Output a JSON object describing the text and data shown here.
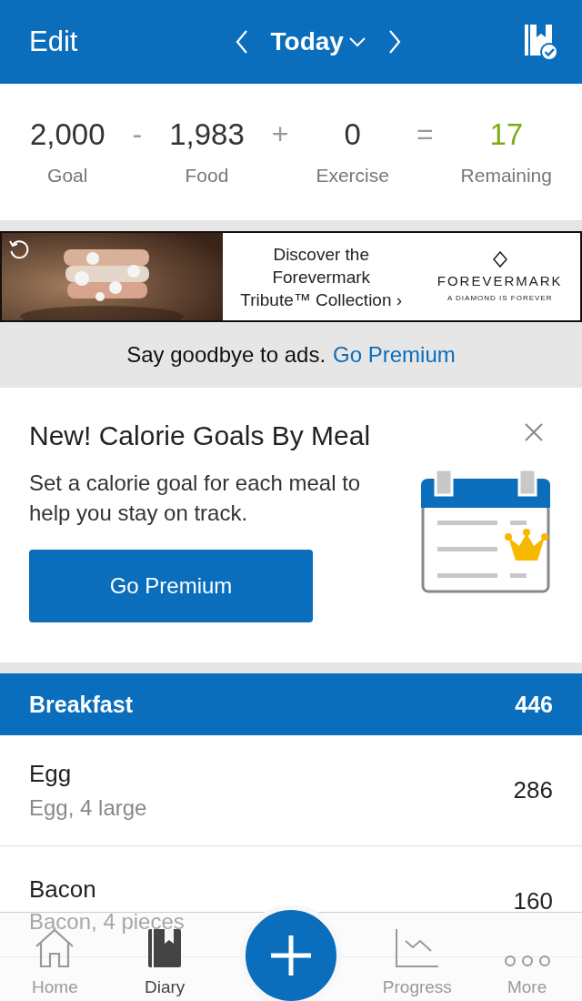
{
  "header": {
    "edit": "Edit",
    "date": "Today"
  },
  "summary": [
    {
      "kind": "term",
      "value": "2,000",
      "label": "Goal"
    },
    {
      "kind": "operator",
      "value": "-"
    },
    {
      "kind": "term",
      "value": "1,983",
      "label": "Food"
    },
    {
      "kind": "operator",
      "value": "+"
    },
    {
      "kind": "term",
      "value": "0",
      "label": "Exercise"
    },
    {
      "kind": "operator",
      "value": "="
    },
    {
      "kind": "result",
      "value": "17",
      "label": "Remaining"
    }
  ],
  "ad": {
    "headline": [
      "Discover the",
      "Forevermark",
      "Tribute™ Collection ›"
    ],
    "brand": "FOREVERMARK",
    "tagline": "A DIAMOND IS FOREVER"
  },
  "premium_bar": {
    "text": "Say goodbye to ads.",
    "link": "Go Premium"
  },
  "promo": {
    "title": "New! Calorie Goals By Meal",
    "body": "Set a calorie goal for each meal to help you stay on track.",
    "button": "Go Premium"
  },
  "meal": {
    "name": "Breakfast",
    "calories": "446",
    "entries": [
      {
        "name": "Egg",
        "detail": "Egg, 4 large",
        "calories": "286"
      },
      {
        "name": "Bacon",
        "detail": "Bacon, 4 pieces",
        "calories": "160"
      }
    ]
  },
  "tabs": [
    {
      "kind": "home",
      "label": "Home",
      "selected": false
    },
    {
      "kind": "diary",
      "label": "Diary",
      "selected": true
    },
    {
      "kind": "add"
    },
    {
      "kind": "progress",
      "label": "Progress",
      "selected": false
    },
    {
      "kind": "more",
      "label": "More",
      "selected": false
    }
  ]
}
